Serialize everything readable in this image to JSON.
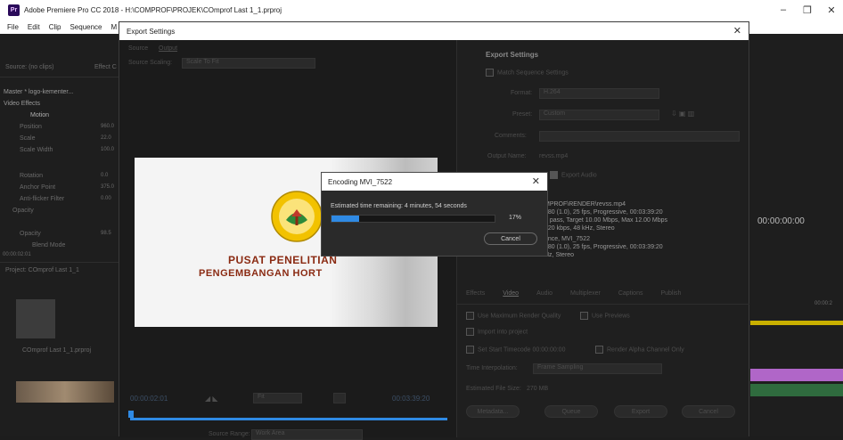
{
  "app": {
    "title": "Adobe Premiere Pro CC 2018 - H:\\COMPROF\\PROJEK\\COmprof Last 1_1.prproj",
    "icon": "Pr",
    "minimize": "–",
    "maximize": "❐",
    "close": "✕"
  },
  "menu": [
    "File",
    "Edit",
    "Clip",
    "Sequence",
    "M"
  ],
  "background": {
    "source_label": "Source: (no clips)",
    "effect_tab": "Effect C",
    "master_label": "Master * logo-kementer...",
    "video_effects": "Video Effects",
    "motion": "Motion",
    "position": "Position",
    "position_val": "960.0",
    "scale": "Scale",
    "scale_val": "22.0",
    "scale_width": "Scale Width",
    "scale_width_val": "100.0",
    "rotation": "Rotation",
    "rotation_val": "0.0",
    "anchor_point": "Anchor Point",
    "anchor_val": "375.0",
    "anti_flicker": "Anti-flicker Filter",
    "anti_flicker_val": "0.00",
    "opacity_section": "Opacity",
    "opacity": "Opacity",
    "opacity_val": "98.5",
    "blend_mode": "Blend Mode",
    "timecode_left": "00:00:02:01",
    "project_label": "Project: COmprof Last 1_1",
    "project_file": "COmprof Last 1_1.prproj",
    "timecode_right": "00:00:00:00",
    "timeline_label": "00:00:2"
  },
  "export_dialog": {
    "title": "Export Settings",
    "close": "✕",
    "source_tab": "Source",
    "output_tab": "Output",
    "source_scaling_label": "Source Scaling:",
    "source_scaling_value": "Scale To Fit",
    "preview_text1": "PUSAT PENELITIAN",
    "preview_text2": "PENGEMBANGAN HORT",
    "timecode_in": "00:00:02:01",
    "fit_label": "Fit",
    "timecode_out": "00:03:39:20",
    "source_range_label": "Source Range:",
    "source_range_value": "Work Area",
    "settings": {
      "header": "Export Settings",
      "match_sequence": "Match Sequence Settings",
      "format_label": "Format:",
      "format_value": "H.264",
      "preset_label": "Preset:",
      "preset_value": "Custom",
      "comments_label": "Comments:",
      "output_name_label": "Output Name:",
      "output_name_value": "revss.mp4",
      "export_audio": "Export Audio",
      "summary_output": "MPROF\\RENDER\\revss.mp4",
      "summary_line2": "080 (1.0), 25 fps, Progressive, 00:03:39:20",
      "summary_line3": "1 pass, Target 10.00 Mbps, Max 12.00 Mbps",
      "summary_line4": "320 kbps, 48 kHz, Stereo",
      "summary_source": "ence, MVI_7522",
      "summary_line6": "080 (1.0), 25 fps, Progressive, 00:03:39:20",
      "summary_line7": "Hz, Stereo"
    },
    "tabs": [
      "Effects",
      "Video",
      "Audio",
      "Multiplexer",
      "Captions",
      "Publish"
    ],
    "use_max_render": "Use Maximum Render Quality",
    "use_previews": "Use Previews",
    "import_into_project": "Import into project",
    "set_start_timecode": "Set Start Timecode",
    "start_timecode_value": "00:00:00:00",
    "render_alpha": "Render Alpha Channel Only",
    "time_interpolation_label": "Time Interpolation:",
    "time_interpolation_value": "Frame Sampling",
    "estimated_size_label": "Estimated File Size:",
    "estimated_size_value": "270 MB",
    "metadata_button": "Metadata...",
    "queue_button": "Queue",
    "export_button": "Export",
    "cancel_button": "Cancel"
  },
  "encoding": {
    "title": "Encoding MVI_7522",
    "close": "✕",
    "estimated": "Estimated time remaining: 4 minutes, 54 seconds",
    "progress_percent": "17%",
    "progress_fraction": 0.17,
    "cancel": "Cancel"
  },
  "colors": {
    "accent": "#2f8ae4",
    "logo_yellow": "#f2c200",
    "logo_red": "#8a2a12"
  }
}
